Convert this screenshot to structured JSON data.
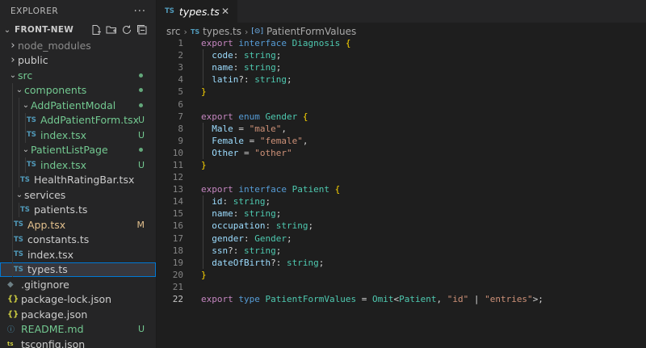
{
  "sidebar": {
    "title": "EXPLORER",
    "more": "···",
    "project": "FRONT-NEW",
    "actions": [
      "new-file-icon",
      "new-folder-icon",
      "refresh-icon",
      "collapse-all-icon"
    ]
  },
  "tree": [
    {
      "name": "node_modules",
      "indent": 0,
      "kind": "folder",
      "open": false,
      "style": "dim"
    },
    {
      "name": "public",
      "indent": 0,
      "kind": "folder",
      "open": false,
      "style": "normal"
    },
    {
      "name": "src",
      "indent": 0,
      "kind": "folder",
      "open": true,
      "style": "green",
      "badge": "dot"
    },
    {
      "name": "components",
      "indent": 1,
      "kind": "folder",
      "open": true,
      "style": "green",
      "badge": "dot"
    },
    {
      "name": "AddPatientModal",
      "indent": 2,
      "kind": "folder",
      "open": true,
      "style": "green",
      "badge": "dot"
    },
    {
      "name": "AddPatientForm.tsx",
      "indent": 3,
      "kind": "ts",
      "style": "green",
      "badge": "U"
    },
    {
      "name": "index.tsx",
      "indent": 3,
      "kind": "ts",
      "style": "green",
      "badge": "U"
    },
    {
      "name": "PatientListPage",
      "indent": 2,
      "kind": "folder",
      "open": true,
      "style": "green",
      "badge": "dot"
    },
    {
      "name": "index.tsx",
      "indent": 3,
      "kind": "ts",
      "style": "green",
      "badge": "U"
    },
    {
      "name": "HealthRatingBar.tsx",
      "indent": 2,
      "kind": "ts",
      "style": "normal"
    },
    {
      "name": "services",
      "indent": 1,
      "kind": "folder",
      "open": true,
      "style": "normal"
    },
    {
      "name": "patients.ts",
      "indent": 2,
      "kind": "ts",
      "style": "normal"
    },
    {
      "name": "App.tsx",
      "indent": 1,
      "kind": "ts",
      "style": "amber",
      "badge": "M"
    },
    {
      "name": "constants.ts",
      "indent": 1,
      "kind": "ts",
      "style": "normal"
    },
    {
      "name": "index.tsx",
      "indent": 1,
      "kind": "ts",
      "style": "normal"
    },
    {
      "name": "types.ts",
      "indent": 1,
      "kind": "ts",
      "style": "normal",
      "selected": true
    },
    {
      "name": ".gitignore",
      "indent": 0,
      "kind": "git",
      "style": "normal"
    },
    {
      "name": "package-lock.json",
      "indent": 0,
      "kind": "json",
      "style": "normal"
    },
    {
      "name": "package.json",
      "indent": 0,
      "kind": "json",
      "style": "normal"
    },
    {
      "name": "README.md",
      "indent": 0,
      "kind": "info",
      "style": "green",
      "badge": "U"
    },
    {
      "name": "tsconfig.json",
      "indent": 0,
      "kind": "tsjson",
      "style": "normal"
    }
  ],
  "tab": {
    "icon": "TS",
    "label": "types.ts",
    "close": "✕"
  },
  "breadcrumb": {
    "folder": "src",
    "file": "types.ts",
    "symbol": "PatientFormValues"
  },
  "code": {
    "active_line": 22,
    "lines": [
      [
        [
          "kw",
          "export"
        ],
        [
          "pn",
          " "
        ],
        [
          "kw2",
          "interface"
        ],
        [
          "pn",
          " "
        ],
        [
          "ty",
          "Diagnosis"
        ],
        [
          "pn",
          " "
        ],
        [
          "br",
          "{"
        ]
      ],
      [
        [
          "pn",
          "  "
        ],
        [
          "pr",
          "code"
        ],
        [
          "pn",
          ": "
        ],
        [
          "ty",
          "string"
        ],
        [
          "pn",
          ";"
        ]
      ],
      [
        [
          "pn",
          "  "
        ],
        [
          "pr",
          "name"
        ],
        [
          "pn",
          ": "
        ],
        [
          "ty",
          "string"
        ],
        [
          "pn",
          ";"
        ]
      ],
      [
        [
          "pn",
          "  "
        ],
        [
          "pr",
          "latin"
        ],
        [
          "pn",
          "?: "
        ],
        [
          "ty",
          "string"
        ],
        [
          "pn",
          ";"
        ]
      ],
      [
        [
          "br",
          "}"
        ]
      ],
      [],
      [
        [
          "kw",
          "export"
        ],
        [
          "pn",
          " "
        ],
        [
          "kw2",
          "enum"
        ],
        [
          "pn",
          " "
        ],
        [
          "ty",
          "Gender"
        ],
        [
          "pn",
          " "
        ],
        [
          "br",
          "{"
        ]
      ],
      [
        [
          "pn",
          "  "
        ],
        [
          "pr",
          "Male"
        ],
        [
          "pn",
          " = "
        ],
        [
          "st",
          "\"male\""
        ],
        [
          "pn",
          ","
        ]
      ],
      [
        [
          "pn",
          "  "
        ],
        [
          "pr",
          "Female"
        ],
        [
          "pn",
          " = "
        ],
        [
          "st",
          "\"female\""
        ],
        [
          "pn",
          ","
        ]
      ],
      [
        [
          "pn",
          "  "
        ],
        [
          "pr",
          "Other"
        ],
        [
          "pn",
          " = "
        ],
        [
          "st",
          "\"other\""
        ]
      ],
      [
        [
          "br",
          "}"
        ]
      ],
      [],
      [
        [
          "kw",
          "export"
        ],
        [
          "pn",
          " "
        ],
        [
          "kw2",
          "interface"
        ],
        [
          "pn",
          " "
        ],
        [
          "ty",
          "Patient"
        ],
        [
          "pn",
          " "
        ],
        [
          "br",
          "{"
        ]
      ],
      [
        [
          "pn",
          "  "
        ],
        [
          "pr",
          "id"
        ],
        [
          "pn",
          ": "
        ],
        [
          "ty",
          "string"
        ],
        [
          "pn",
          ";"
        ]
      ],
      [
        [
          "pn",
          "  "
        ],
        [
          "pr",
          "name"
        ],
        [
          "pn",
          ": "
        ],
        [
          "ty",
          "string"
        ],
        [
          "pn",
          ";"
        ]
      ],
      [
        [
          "pn",
          "  "
        ],
        [
          "pr",
          "occupation"
        ],
        [
          "pn",
          ": "
        ],
        [
          "ty",
          "string"
        ],
        [
          "pn",
          ";"
        ]
      ],
      [
        [
          "pn",
          "  "
        ],
        [
          "pr",
          "gender"
        ],
        [
          "pn",
          ": "
        ],
        [
          "ty",
          "Gender"
        ],
        [
          "pn",
          ";"
        ]
      ],
      [
        [
          "pn",
          "  "
        ],
        [
          "pr",
          "ssn"
        ],
        [
          "pn",
          "?: "
        ],
        [
          "ty",
          "string"
        ],
        [
          "pn",
          ";"
        ]
      ],
      [
        [
          "pn",
          "  "
        ],
        [
          "pr",
          "dateOfBirth"
        ],
        [
          "pn",
          "?: "
        ],
        [
          "ty",
          "string"
        ],
        [
          "pn",
          ";"
        ]
      ],
      [
        [
          "br",
          "}"
        ]
      ],
      [],
      [
        [
          "kw",
          "export"
        ],
        [
          "pn",
          " "
        ],
        [
          "kw2",
          "type"
        ],
        [
          "pn",
          " "
        ],
        [
          "ty",
          "PatientFormValues"
        ],
        [
          "pn",
          " = "
        ],
        [
          "ty",
          "Omit"
        ],
        [
          "pn",
          "<"
        ],
        [
          "ty",
          "Patient"
        ],
        [
          "pn",
          ", "
        ],
        [
          "st",
          "\"id\""
        ],
        [
          "pn",
          " | "
        ],
        [
          "st",
          "\"entries\""
        ],
        [
          "pn",
          ">;"
        ]
      ]
    ]
  }
}
